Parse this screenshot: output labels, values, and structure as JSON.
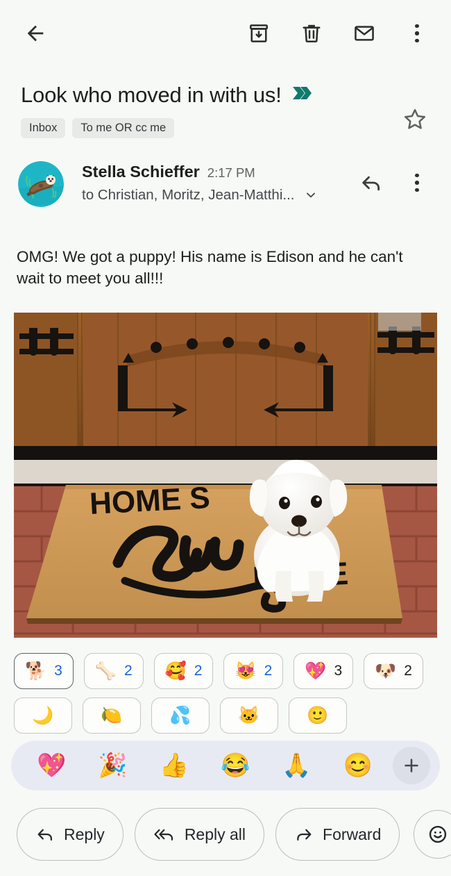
{
  "appbar": {
    "back_label": "Back",
    "actions": [
      {
        "name": "archive-icon",
        "label": "Archive"
      },
      {
        "name": "delete-icon",
        "label": "Delete"
      },
      {
        "name": "mark-unread-icon",
        "label": "Mark as unread"
      },
      {
        "name": "more-options-icon",
        "label": "More options"
      }
    ]
  },
  "subject": {
    "text": "Look who moved in with us!",
    "importance_marker": "important-chevron",
    "importance_color": "#11796d",
    "star_state": "not-starred",
    "labels": [
      "Inbox",
      "To me OR cc me"
    ]
  },
  "message": {
    "sender_name": "Stella Schieffer",
    "time": "2:17 PM",
    "recipients": "to Christian, Moritz, Jean-Matthi...",
    "avatar_alt": "otter-avatar",
    "avatar_bg": "#1eb6c6",
    "body": "OMG! We got a puppy! His name is Edison and he can't wait to meet you all!!!",
    "attachment_alt": "White puppy sitting on a HOME SWEET HOME doormat in front of a wooden door",
    "doormat_text_top": "HOME S",
    "doormat_text_script": "Sweet",
    "doormat_text_bottom": "HOME"
  },
  "reactions": {
    "row1": [
      {
        "emoji": "🐕",
        "name": "dog-reaction",
        "count": "3",
        "selected": true
      },
      {
        "emoji": "🦴",
        "name": "bone-reaction",
        "count": "2",
        "selected": false,
        "count_highlight": true
      },
      {
        "emoji": "🥰",
        "name": "smiling-face-with-hearts-reaction",
        "count": "2",
        "selected": false,
        "count_highlight": true
      },
      {
        "emoji": "😻",
        "name": "heart-eyes-cat-reaction",
        "count": "2",
        "selected": false,
        "count_highlight": true
      },
      {
        "emoji": "💖",
        "name": "sparkling-heart-reaction",
        "count": "3",
        "selected": false,
        "count_highlight": false
      },
      {
        "emoji": "🐶",
        "name": "dog-face-reaction",
        "count": "2",
        "selected": false,
        "count_highlight": false
      }
    ],
    "row2": [
      {
        "emoji": "🌙",
        "name": "reaction-hidden-1",
        "count": "",
        "selected": false
      },
      {
        "emoji": "🍋",
        "name": "reaction-hidden-2",
        "count": "",
        "selected": false
      },
      {
        "emoji": "💦",
        "name": "reaction-hidden-3",
        "count": "",
        "selected": false
      },
      {
        "emoji": "🐱",
        "name": "reaction-hidden-4",
        "count": "",
        "selected": false
      },
      {
        "emoji": "🙂",
        "name": "reaction-hidden-5",
        "count": "",
        "selected": false
      }
    ]
  },
  "emoji_picker": {
    "emojis": [
      {
        "glyph": "💖",
        "name": "sparkling-heart-emoji"
      },
      {
        "glyph": "🎉",
        "name": "party-popper-emoji"
      },
      {
        "glyph": "👍",
        "name": "thumbs-up-emoji"
      },
      {
        "glyph": "😂",
        "name": "face-with-tears-of-joy-emoji"
      },
      {
        "glyph": "🙏",
        "name": "folded-hands-emoji"
      },
      {
        "glyph": "😊",
        "name": "smiling-face-emoji"
      }
    ],
    "more_label": "+"
  },
  "actions": {
    "reply": "Reply",
    "reply_all": "Reply all",
    "forward": "Forward",
    "emoji_button": "Add reaction"
  },
  "colors": {
    "background": "#f7f9f7",
    "accent_blue": "#1a63d8",
    "importance_teal": "#11796d",
    "picker_bg": "#e8eaf3"
  }
}
